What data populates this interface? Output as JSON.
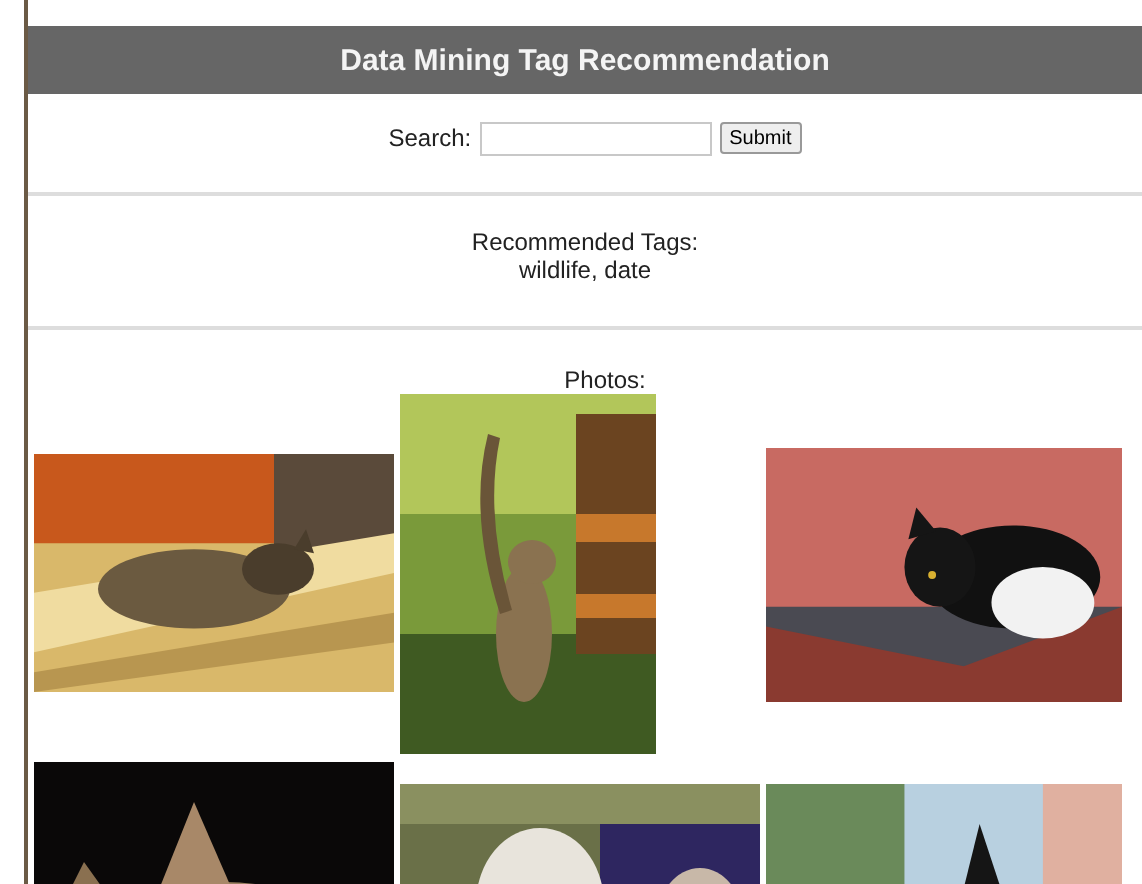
{
  "header": {
    "title": "Data Mining Tag Recommendation"
  },
  "search": {
    "label": "Search:",
    "button": "Submit"
  },
  "recommended": {
    "label": "Recommended Tags:",
    "tags": "wildlife, date"
  },
  "photos": {
    "label": "Photos:"
  }
}
